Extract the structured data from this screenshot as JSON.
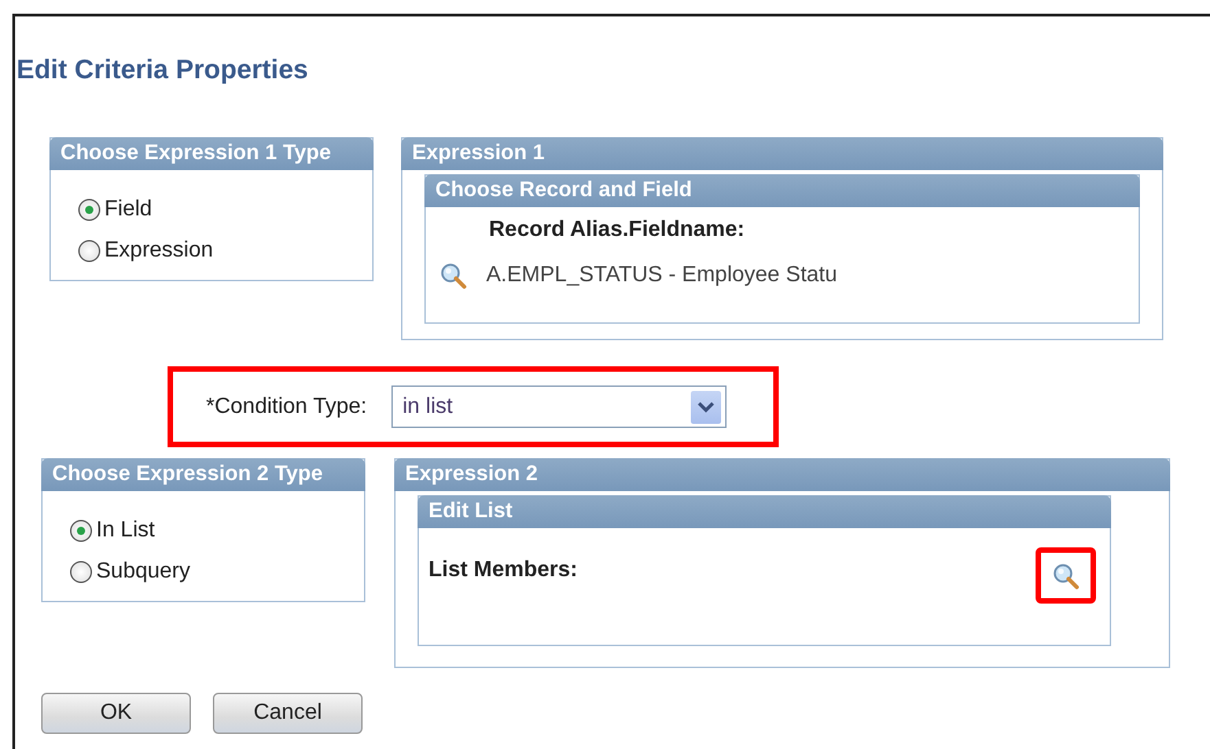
{
  "title": "Edit Criteria Properties",
  "expression1_type": {
    "heading": "Choose Expression 1 Type",
    "options": [
      {
        "label": "Field",
        "selected": true
      },
      {
        "label": "Expression",
        "selected": false
      }
    ]
  },
  "expression1": {
    "heading": "Expression 1",
    "record_field": {
      "heading": "Choose Record and Field",
      "label": "Record Alias.Fieldname:",
      "value": "A.EMPL_STATUS - Employee Statu"
    }
  },
  "condition": {
    "label": "*Condition Type:",
    "value": "in list",
    "highlighted": true
  },
  "expression2_type": {
    "heading": "Choose Expression 2 Type",
    "options": [
      {
        "label": "In List",
        "selected": true
      },
      {
        "label": "Subquery",
        "selected": false
      }
    ]
  },
  "expression2": {
    "heading": "Expression 2",
    "edit_list": {
      "heading": "Edit List",
      "label": "List Members:",
      "search_highlighted": true
    }
  },
  "buttons": [
    "OK",
    "Cancel"
  ]
}
